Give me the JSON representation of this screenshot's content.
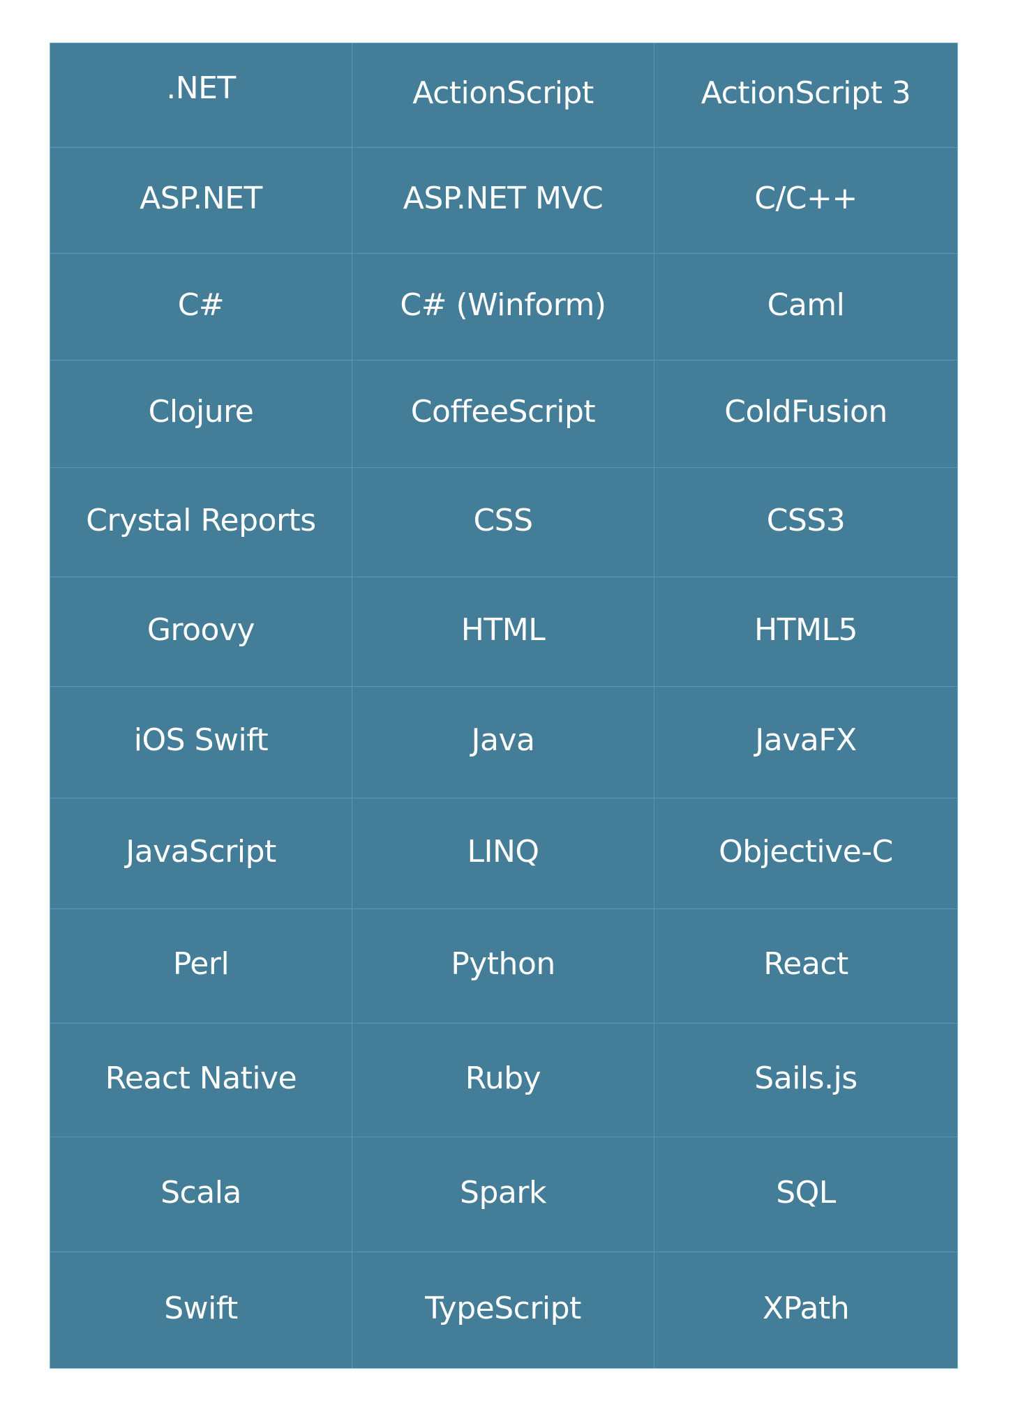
{
  "table": {
    "rows": [
      [
        ".NET",
        "ActionScript",
        "ActionScript 3"
      ],
      [
        "ASP.NET",
        "ASP.NET MVC",
        "C/C++"
      ],
      [
        "C#",
        "C# (Winform)",
        "Caml"
      ],
      [
        "Clojure",
        "CoffeeScript",
        "ColdFusion"
      ],
      [
        "Crystal Reports",
        "CSS",
        "CSS3"
      ],
      [
        "Groovy",
        "HTML",
        "HTML5"
      ],
      [
        "iOS Swift",
        "Java",
        "JavaFX"
      ],
      [
        "JavaScript",
        "LINQ",
        "Objective-C"
      ],
      [
        "Perl",
        "Python",
        "React"
      ],
      [
        "React Native",
        "Ruby",
        "Sails.js"
      ],
      [
        "Scala",
        "Spark",
        "SQL"
      ],
      [
        "Swift",
        "TypeScript",
        "XPath"
      ]
    ]
  },
  "colors": {
    "cell_background": "#447d98",
    "grid_line": "#4e9ac1",
    "text": "#ffffff",
    "page_background": "#ffffff"
  }
}
